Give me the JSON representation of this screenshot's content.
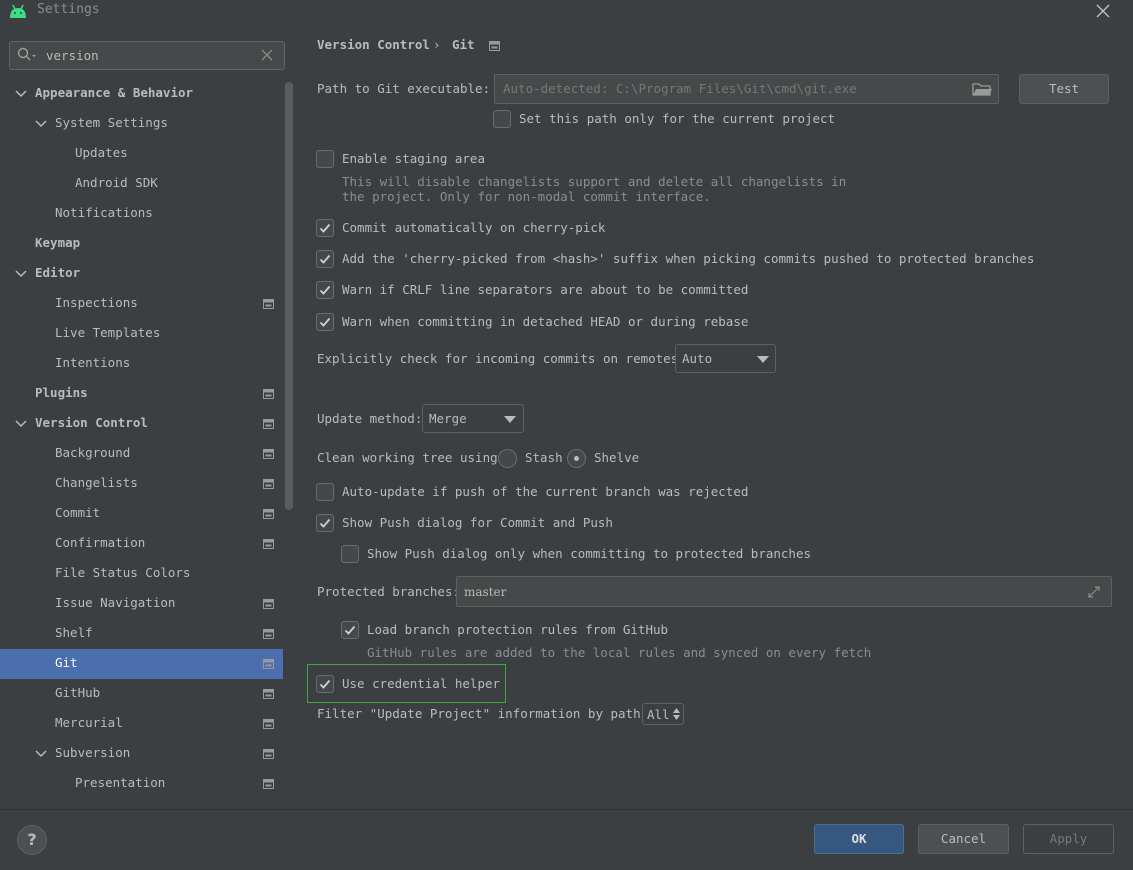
{
  "window": {
    "title": "Settings"
  },
  "search": {
    "value": "version"
  },
  "sidebar": {
    "items": [
      {
        "label": "Appearance & Behavior",
        "bold": true,
        "chevron": true,
        "icon": false
      },
      {
        "label": "System Settings",
        "bold": false,
        "chevron": true,
        "icon": false
      },
      {
        "label": "Updates",
        "bold": false,
        "chevron": false,
        "icon": false
      },
      {
        "label": "Android SDK",
        "bold": false,
        "chevron": false,
        "icon": false
      },
      {
        "label": "Notifications",
        "bold": false,
        "chevron": false,
        "icon": false
      },
      {
        "label": "Keymap",
        "bold": true,
        "chevron": false,
        "icon": false
      },
      {
        "label": "Editor",
        "bold": true,
        "chevron": true,
        "icon": false
      },
      {
        "label": "Inspections",
        "bold": false,
        "chevron": false,
        "icon": true
      },
      {
        "label": "Live Templates",
        "bold": false,
        "chevron": false,
        "icon": false
      },
      {
        "label": "Intentions",
        "bold": false,
        "chevron": false,
        "icon": false
      },
      {
        "label": "Plugins",
        "bold": true,
        "chevron": false,
        "icon": true
      },
      {
        "label": "Version Control",
        "bold": true,
        "chevron": true,
        "icon": true
      },
      {
        "label": "Background",
        "bold": false,
        "chevron": false,
        "icon": true
      },
      {
        "label": "Changelists",
        "bold": false,
        "chevron": false,
        "icon": true
      },
      {
        "label": "Commit",
        "bold": false,
        "chevron": false,
        "icon": true
      },
      {
        "label": "Confirmation",
        "bold": false,
        "chevron": false,
        "icon": true
      },
      {
        "label": "File Status Colors",
        "bold": false,
        "chevron": false,
        "icon": false
      },
      {
        "label": "Issue Navigation",
        "bold": false,
        "chevron": false,
        "icon": true
      },
      {
        "label": "Shelf",
        "bold": false,
        "chevron": false,
        "icon": true
      },
      {
        "label": "Git",
        "bold": false,
        "chevron": false,
        "icon": true,
        "selected": true
      },
      {
        "label": "GitHub",
        "bold": false,
        "chevron": false,
        "icon": true
      },
      {
        "label": "Mercurial",
        "bold": false,
        "chevron": false,
        "icon": true
      },
      {
        "label": "Subversion",
        "bold": false,
        "chevron": true,
        "icon": true
      },
      {
        "label": "Presentation",
        "bold": false,
        "chevron": false,
        "icon": true
      }
    ]
  },
  "breadcrumb": {
    "parent": "Version Control",
    "separator": "›",
    "current": "Git"
  },
  "git_path": {
    "label": "Path to Git executable:",
    "placeholder": "Auto-detected: C:\\Program Files\\Git\\cmd\\git.exe",
    "test_button": "Test",
    "project_only_label": "Set this path only for the current project",
    "project_only_checked": false
  },
  "staging": {
    "label": "Enable staging area",
    "checked": false,
    "hint_line1": "This will disable changelists support and delete all changelists in",
    "hint_line2": "the project. Only for non-modal commit interface."
  },
  "options": {
    "cherry_pick": "Commit automatically on cherry-pick",
    "cherry_suffix": "Add the 'cherry-picked from <hash>' suffix when picking commits pushed to protected branches",
    "crlf": "Warn if CRLF line separators are about to be committed",
    "detached": "Warn when committing in detached HEAD or during rebase"
  },
  "incoming": {
    "label": "Explicitly check for incoming commits on remotes:",
    "value": "Auto"
  },
  "update_method": {
    "label": "Update method:",
    "value": "Merge"
  },
  "clean_tree": {
    "label": "Clean working tree using:",
    "stash": "Stash",
    "shelve": "Shelve",
    "selected": "Shelve"
  },
  "push": {
    "auto_update": "Auto-update if push of the current branch was rejected",
    "show_dialog": "Show Push dialog for Commit and Push",
    "only_protected": "Show Push dialog only when committing to protected branches"
  },
  "protected": {
    "label": "Protected branches:",
    "value": "master",
    "load_rules": "Load branch protection rules from GitHub",
    "hint": "GitHub rules are added to the local rules and synced on every fetch"
  },
  "credential": {
    "label": "Use credential helper",
    "checked": true
  },
  "filter": {
    "label": "Filter \"Update Project\" information by paths:",
    "value": "All"
  },
  "footer": {
    "help": "?",
    "ok": "OK",
    "cancel": "Cancel",
    "apply": "Apply"
  },
  "colors": {
    "accent": "#4b6eaf",
    "highlight": "#3fa83f",
    "ok_button": "#365880"
  }
}
